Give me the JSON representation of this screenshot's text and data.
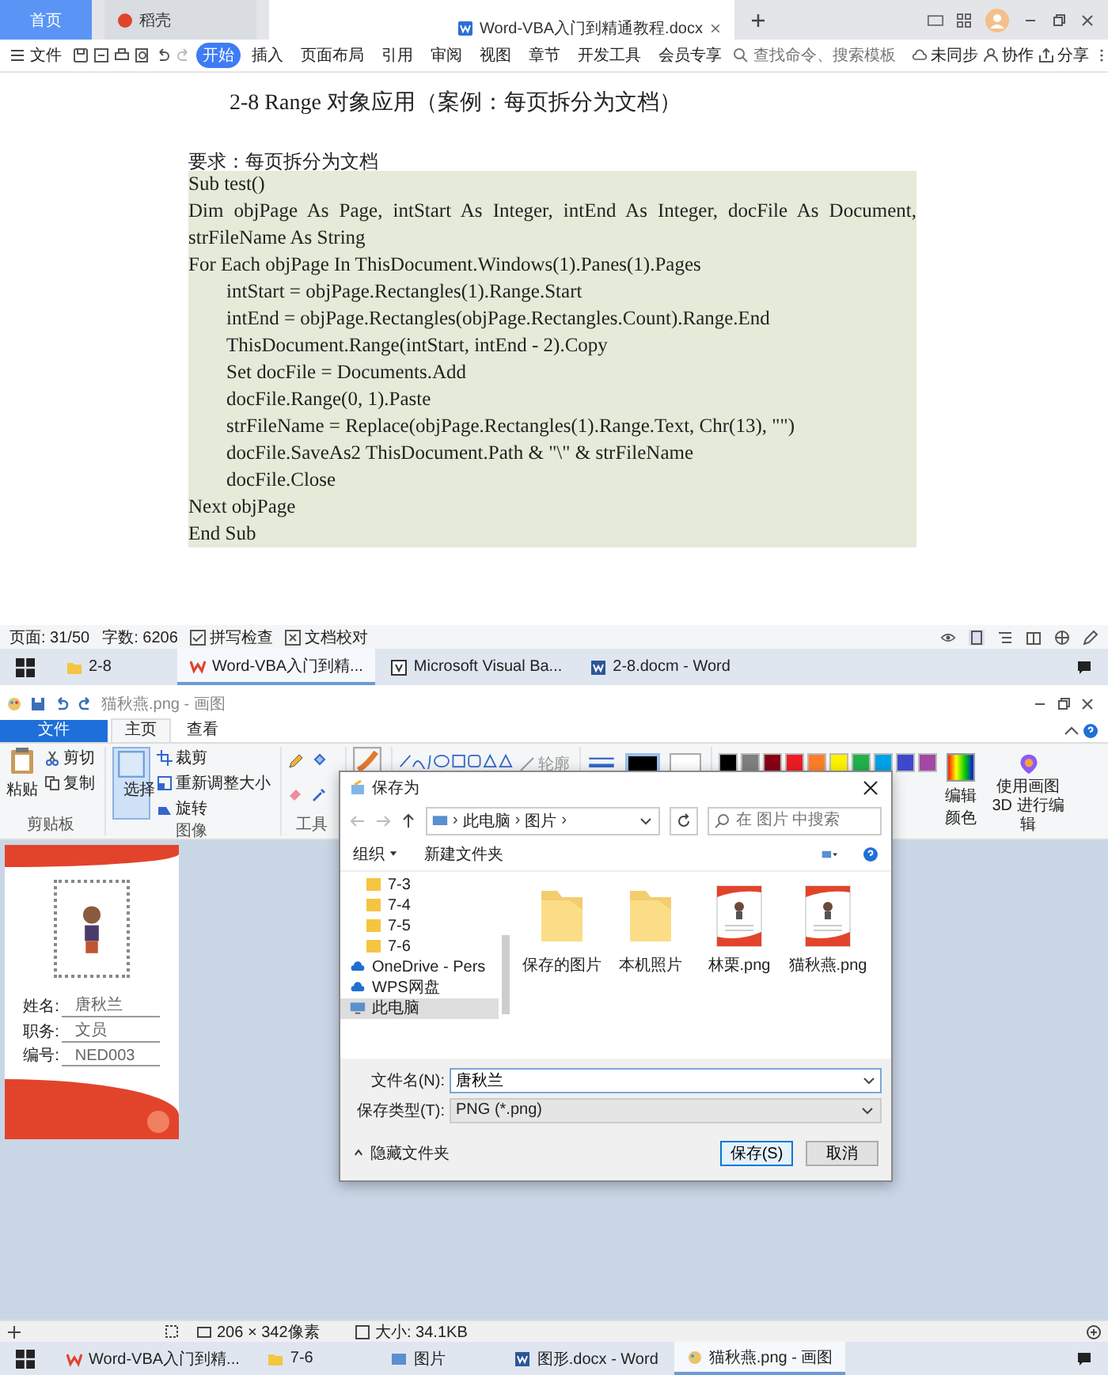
{
  "wps": {
    "tabs": [
      {
        "label": "首页",
        "kind": "home",
        "selected": false
      },
      {
        "label": "稻壳",
        "kind": "app",
        "selected": false
      },
      {
        "label": "Word-VBA入门到精通教程.docx",
        "kind": "doc",
        "selected": true
      }
    ],
    "file_menu": "文件",
    "ribbon_tabs": [
      {
        "label": "开始",
        "selected": true
      },
      {
        "label": "插入",
        "selected": false
      },
      {
        "label": "页面布局",
        "selected": false
      },
      {
        "label": "引用",
        "selected": false
      },
      {
        "label": "审阅",
        "selected": false
      },
      {
        "label": "视图",
        "selected": false
      },
      {
        "label": "章节",
        "selected": false
      },
      {
        "label": "开发工具",
        "selected": false
      },
      {
        "label": "会员专享",
        "selected": false
      }
    ],
    "search": {
      "placeholder": "查找命令、搜索模板"
    },
    "actions": [
      {
        "label": "未同步",
        "kind": "cloud"
      },
      {
        "label": "协作",
        "kind": "people"
      },
      {
        "label": "分享",
        "kind": "share"
      }
    ],
    "document": {
      "heading": "2-8 Range 对象应用（案例：每页拆分为文档）",
      "requirement": "要求：每页拆分为文档",
      "code": [
        {
          "text": "Sub test()"
        },
        {
          "text": "Dim objPage As Page, intStart As Integer, intEnd As Integer, docFile As Document, strFileName As String"
        },
        {
          "text": "For Each objPage In ThisDocument.Windows(1).Panes(1).Pages",
          "children": [
            {
              "text": "intStart = objPage.Rectangles(1).Range.Start"
            },
            {
              "text": "intEnd = objPage.Rectangles(objPage.Rectangles.Count).Range.End"
            },
            {
              "text": "ThisDocument.Range(intStart, intEnd - 2).Copy"
            },
            {
              "text": "Set docFile = Documents.Add"
            },
            {
              "text": "docFile.Range(0, 1).Paste"
            },
            {
              "text": "strFileName = Replace(objPage.Rectangles(1).Range.Text, Chr(13), \"\")"
            },
            {
              "text": "docFile.SaveAs2 ThisDocument.Path & \"\\\" & strFileName"
            },
            {
              "text": "docFile.Close"
            }
          ]
        },
        {
          "text": "Next objPage"
        },
        {
          "text": "End Sub"
        }
      ]
    },
    "status_bar": {
      "page": "页面: 31/50",
      "words": "字数: 6206",
      "spell_check": "拼写检查",
      "proofread": "文档校对"
    },
    "taskbar": [
      {
        "label": "2-8",
        "kind": "folder",
        "selected": false
      },
      {
        "label": "Word-VBA入门到精...",
        "kind": "wps",
        "selected": true
      },
      {
        "label": "Microsoft Visual Ba...",
        "kind": "vba",
        "selected": false
      },
      {
        "label": "2-8.docm - Word",
        "kind": "word",
        "selected": false
      }
    ]
  },
  "paint": {
    "title": "猫秋燕.png - 画图",
    "tabs": [
      {
        "label": "文件",
        "kind": "file",
        "selected": false
      },
      {
        "label": "主页",
        "kind": "tab",
        "selected": true
      },
      {
        "label": "查看",
        "kind": "tab",
        "selected": false
      }
    ],
    "clipboard": {
      "paste": "粘贴",
      "cut": "剪切",
      "copy": "复制",
      "label": "剪贴板"
    },
    "image": {
      "select": "选择",
      "crop": "裁剪",
      "resize": "重新调整大小",
      "rotate": "旋转",
      "label": "图像"
    },
    "tools": {
      "label": "工具"
    },
    "outline": "轮廓",
    "palette": [
      {
        "color": "#000000"
      },
      {
        "color": "#7f7f7f"
      },
      {
        "color": "#880015"
      },
      {
        "color": "#ed1c24"
      },
      {
        "color": "#ff7f27"
      },
      {
        "color": "#fff200"
      },
      {
        "color": "#22b14c"
      },
      {
        "color": "#00a2e8"
      },
      {
        "color": "#3f48cc"
      },
      {
        "color": "#a349a4"
      }
    ],
    "edit_colors": "编辑颜色",
    "paint3d": "使用画图 3D 进行编辑",
    "card": {
      "fields": [
        {
          "label": "姓名:",
          "value": "唐秋兰"
        },
        {
          "label": "职务:",
          "value": "文员"
        },
        {
          "label": "编号:",
          "value": "NED003"
        }
      ]
    },
    "status_bar": {
      "dimensions": "206 × 342像素",
      "size": "大小: 34.1KB"
    },
    "dialog": {
      "title": "保存为",
      "path": [
        "此电脑",
        "图片"
      ],
      "separator": "›",
      "search": {
        "placeholder": "在 图片 中搜索"
      },
      "toolbar": [
        "组织",
        "新建文件夹"
      ],
      "nav": [
        {
          "label": "7-3",
          "kind": "folder",
          "selected": false
        },
        {
          "label": "7-4",
          "kind": "folder",
          "selected": false
        },
        {
          "label": "7-5",
          "kind": "folder",
          "selected": false
        },
        {
          "label": "7-6",
          "kind": "folder",
          "selected": false
        },
        {
          "label": "OneDrive - Pers",
          "kind": "cloud",
          "selected": false
        },
        {
          "label": "WPS网盘",
          "kind": "cloud",
          "selected": false
        },
        {
          "label": "此电脑",
          "kind": "pc",
          "selected": true
        }
      ],
      "files": [
        {
          "name": "保存的图片",
          "kind": "folder"
        },
        {
          "name": "本机照片",
          "kind": "folder"
        },
        {
          "name": "林栗.png",
          "kind": "image"
        },
        {
          "name": "猫秋燕.png",
          "kind": "image"
        }
      ],
      "filename": {
        "label": "文件名(N):",
        "value": "唐秋兰"
      },
      "filetype": {
        "label": "保存类型(T):",
        "value": "PNG (*.png)"
      },
      "hide_folders": "隐藏文件夹",
      "buttons": [
        {
          "label": "保存(S)",
          "kind": "primary"
        },
        {
          "label": "取消",
          "kind": "secondary"
        }
      ]
    },
    "taskbar": [
      {
        "label": "Word-VBA入门到精...",
        "kind": "wps",
        "selected": false
      },
      {
        "label": "7-6",
        "kind": "folder",
        "selected": false
      },
      {
        "label": "图片",
        "kind": "explorer",
        "selected": false
      },
      {
        "label": "图形.docx - Word",
        "kind": "word",
        "selected": false
      },
      {
        "label": "猫秋燕.png - 画图",
        "kind": "paint",
        "selected": true
      }
    ]
  }
}
